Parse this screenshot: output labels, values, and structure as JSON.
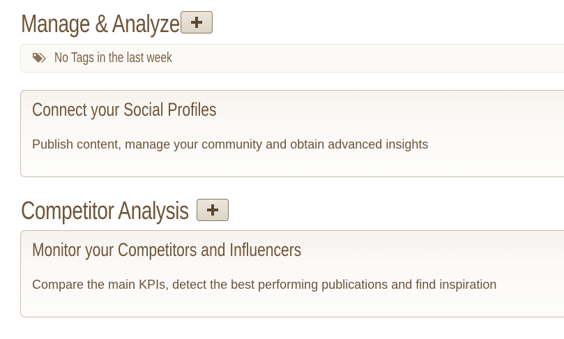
{
  "manage_section": {
    "title": "Manage & Analyze",
    "add_button_icon": "plus-icon",
    "tags": {
      "icon": "tags-icon",
      "text": "No Tags in the last week"
    },
    "card": {
      "title": "Connect your Social Profiles",
      "description": "Publish content, manage your community and obtain advanced insights"
    }
  },
  "competitor_section": {
    "title": "Competitor Analysis",
    "add_button_icon": "plus-icon",
    "card": {
      "title": "Monitor your Competitors and Influencers",
      "description": "Compare the main KPIs, detect the best performing publications and find inspiration"
    }
  },
  "colors": {
    "heading": "#6e5437",
    "body_text": "#6b5338",
    "button_bg": "#e4ddd2",
    "card_border": "#c9bca9"
  }
}
